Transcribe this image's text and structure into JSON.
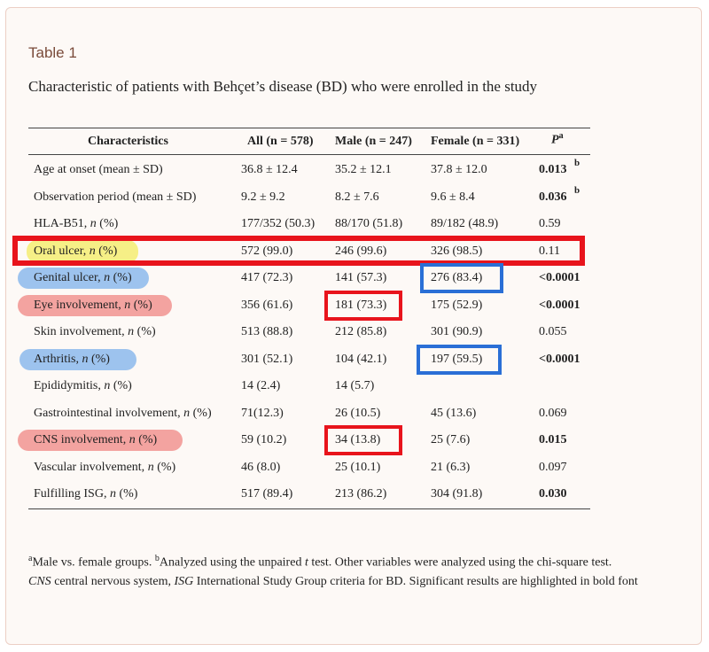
{
  "table_label": "Table 1",
  "caption": "Characteristic of patients with Behçet’s disease (BD) who were enrolled in the study",
  "headers": {
    "characteristics": "Characteristics",
    "all": "All (n = 578)",
    "male": "Male (n = 247)",
    "female": "Female (n = 331)",
    "p": "P",
    "p_sup": "a"
  },
  "rows": [
    {
      "label": "Age at onset (mean ± SD)",
      "all": "36.8 ± 12.4",
      "male": "35.2 ± 12.1",
      "female": "37.8 ± 12.0",
      "p": "0.013",
      "p_sup": "b",
      "bold": true
    },
    {
      "label": "Observation period (mean ± SD)",
      "all": "9.2 ± 9.2",
      "male": "8.2 ± 7.6",
      "female": "9.6 ± 8.4",
      "p": "0.036",
      "p_sup": "b",
      "bold": true
    },
    {
      "label": "HLA-B51, n (%)",
      "all": "177/352 (50.3)",
      "male": "88/170 (51.8)",
      "female": "89/182 (48.9)",
      "p": "0.59",
      "bold": false
    },
    {
      "label": "Oral ulcer, n (%)",
      "all": "572 (99.0)",
      "male": "246 (99.6)",
      "female": "326 (98.5)",
      "p": "0.11",
      "bold": false
    },
    {
      "label": "Genital ulcer, n (%)",
      "all": "417 (72.3)",
      "male": "141 (57.3)",
      "female": "276 (83.4)",
      "p": "<0.0001",
      "bold": true
    },
    {
      "label": "Eye involvement, n (%)",
      "all": "356 (61.6)",
      "male": "181 (73.3)",
      "female": "175 (52.9)",
      "p": "<0.0001",
      "bold": true
    },
    {
      "label": "Skin involvement, n (%)",
      "all": "513 (88.8)",
      "male": "212 (85.8)",
      "female": "301 (90.9)",
      "p": "0.055",
      "bold": false
    },
    {
      "label": "Arthritis, n (%)",
      "all": "301 (52.1)",
      "male": "104 (42.1)",
      "female": "197 (59.5)",
      "p": "<0.0001",
      "bold": true
    },
    {
      "label": "Epididymitis, n (%)",
      "all": "14 (2.4)",
      "male": "14 (5.7)",
      "female": "",
      "p": "",
      "bold": false
    },
    {
      "label": "Gastrointestinal involvement, n (%)",
      "all": "71(12.3)",
      "male": "26 (10.5)",
      "female": "45 (13.6)",
      "p": "0.069",
      "bold": false
    },
    {
      "label": "CNS involvement, n (%)",
      "all": "59 (10.2)",
      "male": "34 (13.8)",
      "female": "25 (7.6)",
      "p": "0.015",
      "bold": true
    },
    {
      "label": "Vascular involvement, n (%)",
      "all": "46 (8.0)",
      "male": "25 (10.1)",
      "female": "21 (6.3)",
      "p": "0.097",
      "bold": false
    },
    {
      "label": "Fulfilling ISG, n (%)",
      "all": "517 (89.4)",
      "male": "213 (86.2)",
      "female": "304 (91.8)",
      "p": "0.030",
      "bold": true
    }
  ],
  "footnote": {
    "a_sup": "a",
    "a_text": "Male vs. female groups. ",
    "b_sup": "b",
    "b_text": "Analyzed using the unpaired ",
    "t": "t",
    "b_text2": " test. Other variables were analyzed using the chi-square test.",
    "cns": "CNS",
    "cns_text": " central nervous system, ",
    "isg": "ISG",
    "isg_text": " International Study Group criteria for BD. Significant results are highlighted in bold font"
  },
  "colors": {
    "highlight_yellow": "#f6ef86",
    "highlight_blue": "#9dc3ee",
    "highlight_red": "#f3a3a0",
    "box_red": "#e8141c",
    "box_blue": "#2a6fd6"
  }
}
